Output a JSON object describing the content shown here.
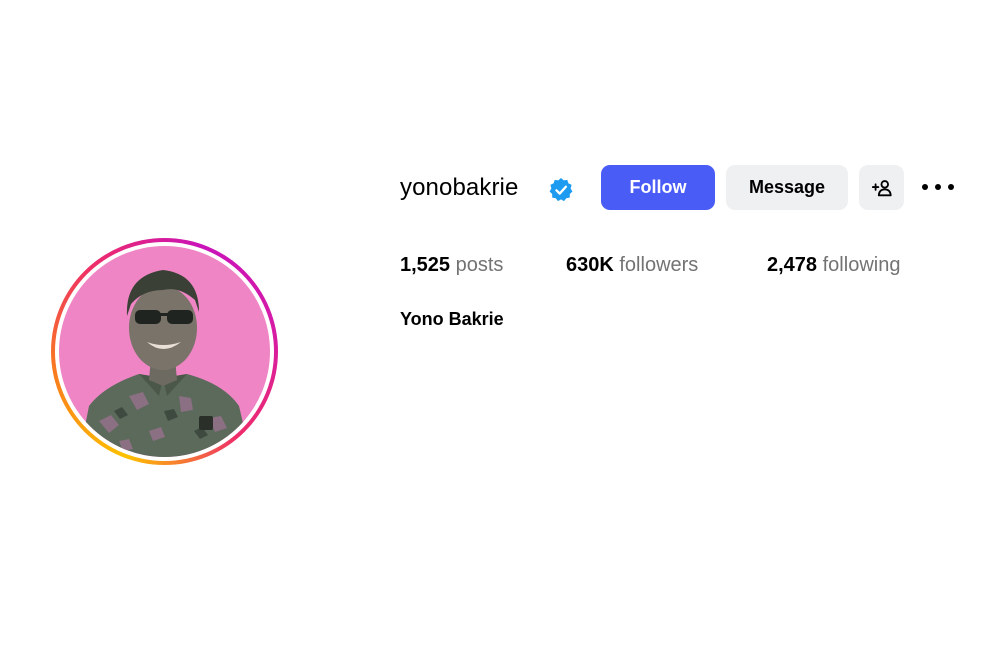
{
  "profile": {
    "username": "yonobakrie",
    "full_name": "Yono Bakrie",
    "verified": true
  },
  "actions": {
    "follow_label": "Follow",
    "message_label": "Message",
    "suggest_icon": "person-add-icon",
    "more_icon": "more-options-icon"
  },
  "stats": {
    "posts": {
      "value": "1,525",
      "label": "posts"
    },
    "followers": {
      "value": "630K",
      "label": "followers"
    },
    "following": {
      "value": "2,478",
      "label": "following"
    }
  },
  "colors": {
    "follow_button": "#4a5cf6",
    "secondary_button": "#eff0f2",
    "verified_badge": "#1d9bf0",
    "muted_text": "#737373",
    "avatar_background": "#ef85c4"
  }
}
